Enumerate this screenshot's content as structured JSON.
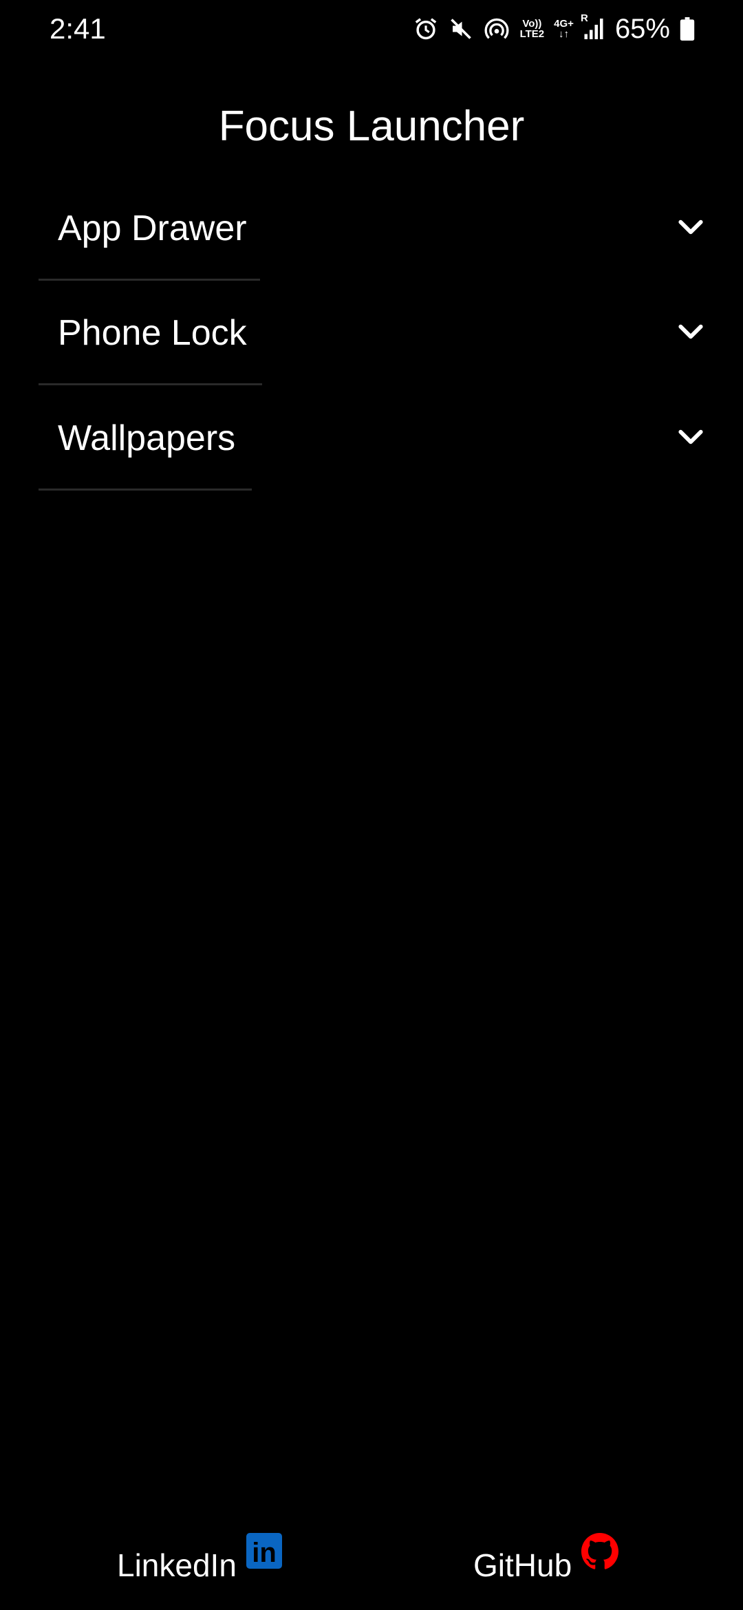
{
  "status_bar": {
    "time": "2:41",
    "net_volte": "Vo))",
    "net_lte": "LTE2",
    "net_4g": "4G+",
    "net_roaming": "R",
    "battery_percent": "65%",
    "icons": [
      "alarm-icon",
      "mute-icon",
      "hotspot-icon",
      "volte-icon",
      "4g-data-icon",
      "signal-icon",
      "battery-icon"
    ]
  },
  "title": "Focus Launcher",
  "sections": [
    {
      "label": "App Drawer",
      "expanded": false
    },
    {
      "label": "Phone Lock",
      "expanded": false
    },
    {
      "label": "Wallpapers",
      "expanded": false
    }
  ],
  "footer": {
    "linkedin_label": "LinkedIn",
    "linkedin_icon_text": "in",
    "github_label": "GitHub"
  },
  "colors": {
    "background": "#000000",
    "text": "#ffffff",
    "divider": "#2a2a2a",
    "linkedin": "#0a66c2",
    "github": "#ff0000"
  }
}
